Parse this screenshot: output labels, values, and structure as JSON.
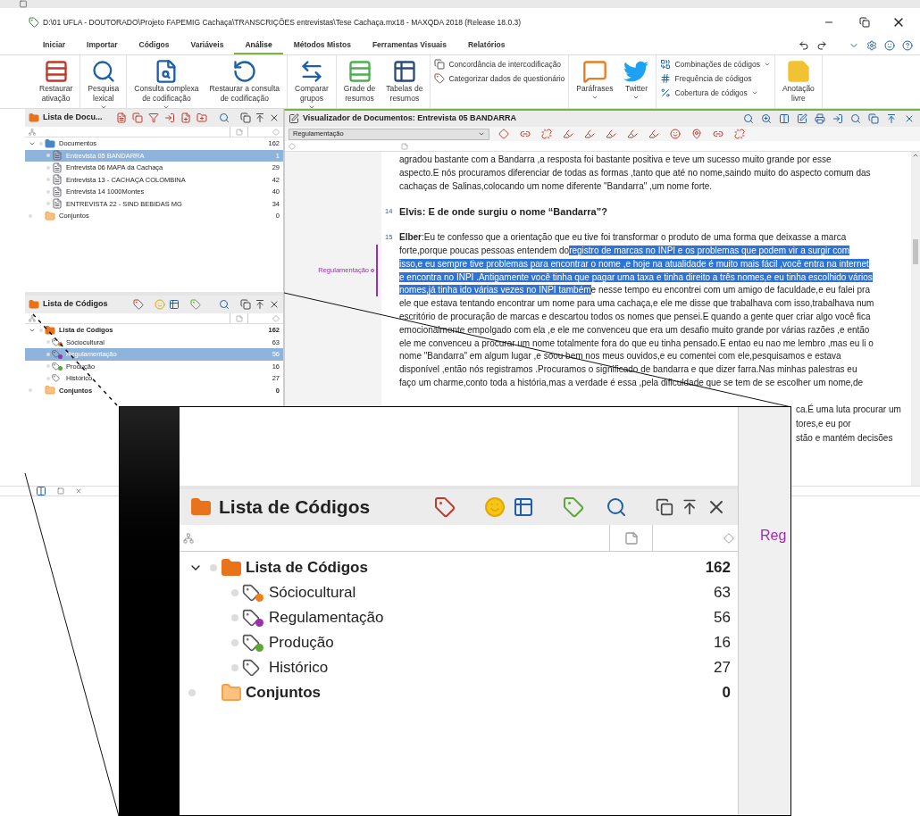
{
  "window": {
    "title": "D:\\01 UFLA - DOUTORADO\\Projeto FAPEMIG Cachaça\\TRANSCRIÇÕES entrevistas\\Tese Cachaça.mx18 - MAXQDA 2018  (Release 18.0.3)"
  },
  "menu_tabs": [
    {
      "label": "Iniciar",
      "selected": false
    },
    {
      "label": "Importar",
      "selected": false
    },
    {
      "label": "Códigos",
      "selected": false
    },
    {
      "label": "Variáveis",
      "selected": false
    },
    {
      "label": "Análise",
      "selected": true
    },
    {
      "label": "Métodos Mistos",
      "selected": false
    },
    {
      "label": "Ferramentas Visuais",
      "selected": false
    },
    {
      "label": "Relatórios",
      "selected": false
    }
  ],
  "ribbon": [
    {
      "kind": "large",
      "items": [
        {
          "lines": [
            "Restaurar",
            "ativação"
          ],
          "menu": false
        }
      ]
    },
    {
      "kind": "large",
      "items": [
        {
          "lines": [
            "Pesquisa",
            "lexical"
          ],
          "menu": true
        }
      ]
    },
    {
      "kind": "large",
      "items": [
        {
          "lines": [
            "Consulta complexa",
            "de codificação"
          ],
          "menu": true
        },
        {
          "lines": [
            "Restaurar a consulta",
            "de codificação"
          ],
          "menu": false
        }
      ]
    },
    {
      "kind": "large",
      "items": [
        {
          "lines": [
            "Comparar",
            "grupos"
          ],
          "menu": true
        }
      ]
    },
    {
      "kind": "large",
      "items": [
        {
          "lines": [
            "Grade de",
            "resumos"
          ],
          "menu": false
        },
        {
          "lines": [
            "Tabelas de",
            "resumos"
          ],
          "menu": false
        }
      ]
    },
    {
      "kind": "stack",
      "items": [
        {
          "label": "Concordância de intercodificação",
          "menu": false
        },
        {
          "label": "Categorizar dados de questionário",
          "menu": false
        }
      ]
    },
    {
      "kind": "large",
      "items": [
        {
          "lines": [
            "Paráfrases"
          ],
          "menu": true
        },
        {
          "lines": [
            "Twitter"
          ],
          "menu": true
        }
      ]
    },
    {
      "kind": "stack",
      "items": [
        {
          "label": "Combinações de códigos",
          "menu": true
        },
        {
          "label": "Frequência de códigos",
          "menu": false
        },
        {
          "label": "Cobertura de códigos",
          "menu": true
        }
      ]
    },
    {
      "kind": "large",
      "items": [
        {
          "lines": [
            "Anotação",
            "livre"
          ],
          "menu": false
        }
      ]
    }
  ],
  "document_list": {
    "title": "Lista de Docu...",
    "root": {
      "label": "Documentos",
      "count": "162",
      "expanded": true,
      "children": [
        {
          "label": "Entrevista 05 BANDARRA",
          "count": "1",
          "selected": true
        },
        {
          "label": "Entrevista 06 MAPA da Cachaça",
          "count": "29",
          "selected": false
        },
        {
          "label": "Entrevista 13 - CACHAÇA COLOMBINA",
          "count": "42",
          "selected": false
        },
        {
          "label": "Entrevista 14 1000Montes",
          "count": "40",
          "selected": false
        },
        {
          "label": "ENTREVISTA 22 - SIND BEBIDAS MG",
          "count": "34",
          "selected": false
        }
      ]
    },
    "sets": {
      "label": "Conjuntos",
      "count": "0"
    }
  },
  "code_list": {
    "title": "Lista de Códigos",
    "root": {
      "label": "Lista de Códigos",
      "count": "162",
      "expanded": true,
      "children": [
        {
          "label": "Sóciocultural",
          "count": "63",
          "selected": false,
          "color": "#f07f1a"
        },
        {
          "label": "Regulamentação",
          "count": "56",
          "selected": true,
          "color": "#9b2fae"
        },
        {
          "label": "Produção",
          "count": "16",
          "selected": false,
          "color": "#5aa832"
        },
        {
          "label": "Histórico",
          "count": "27",
          "selected": false
        }
      ]
    },
    "sets": {
      "label": "Conjuntos",
      "count": "0"
    }
  },
  "viewer": {
    "title": "Visualizador de Documentos: Entrevista 05 BANDARRA",
    "code_dropdown": "Regulamentação",
    "coding_stripe": {
      "label": "Regulamentação",
      "color": "#9b2fae"
    },
    "paragraphs": [
      {
        "bold": false,
        "lines": [
          [
            {
              "text": "agradou bastante com a Bandarra ,a resposta foi bastante positiva e teve um sucesso muito grande por esse",
              "highlighted": false
            }
          ],
          [
            {
              "text": "aspecto.E nós procuramos diferenciar de todas as formas ,tanto que até no nome,saindo muito do aspecto comum das",
              "highlighted": false
            }
          ],
          [
            {
              "text": "cachaças de Salinas,colocando um nome diferente \"Bandarra\" ,um nome forte.",
              "highlighted": false
            }
          ]
        ]
      },
      {
        "number": "14",
        "bold": true,
        "lines": [
          [
            {
              "text": "Elvis: E de onde surgiu o nome “Bandarra”?",
              "highlighted": false
            }
          ]
        ]
      },
      {
        "number": "15",
        "bold": false,
        "lines": [
          [
            {
              "text": "**Elber**:Eu te confesso que a orientação que eu tive foi transformar o produto de uma forma que deixasse a marca",
              "highlighted": false
            }
          ],
          [
            {
              "text": "forte,porque poucas pessoas entendem do",
              "highlighted": false
            },
            {
              "text": "registro de marcas no INPI e os problemas que podem vir a surgir com",
              "highlighted": true
            }
          ],
          [
            {
              "text": "isso,e eu sempre tive problemas para encontrar o nome ,e hoje na atualidade é muito mais fácil ,você entra na internet",
              "highlighted": true
            }
          ],
          [
            {
              "text": "e encontra no INPI .Antigamente você tinha que pagar uma taxa e tinha direito a três nomes,e eu tinha escolhido vários",
              "highlighted": true
            }
          ],
          [
            {
              "text": "nomes,já tinha ido várias vezes no INPI também",
              "highlighted": true
            },
            {
              "text": "e nesse tempo eu encontrei com um amigo de faculdade,e eu falei pra",
              "highlighted": false
            }
          ],
          [
            {
              "text": "ele que estava tentando encontrar um nome para uma cachaça,e ele me disse que trabalhava com isso,trabalhava num",
              "highlighted": false
            }
          ],
          [
            {
              "text": "escritório de procuração de marcas e descartou todos os nomes que pensei.E quando a gente quer criar algo você fica",
              "highlighted": false
            }
          ],
          [
            {
              "text": "emocionalmente empolgado com ela ,e ele me convenceu que era um desafio muito grande por várias razões ,e então",
              "highlighted": false
            }
          ],
          [
            {
              "text": "ele me convenceu a procurar um nome totalmente fora do que eu tinha pensado.E entao eu nao me lembro ,mas eu li o",
              "highlighted": false
            }
          ],
          [
            {
              "text": "nome \"Bandarra\" em algum lugar ,e soou bem nos meus ouvidos,e eu comentei com ele,pesquisamos e estava",
              "highlighted": false
            }
          ],
          [
            {
              "text": "disponível ,então nós registramos .Procuramos o significado de bandarra e que dizer farra.Nas minhas palestras eu",
              "highlighted": false
            }
          ],
          [
            {
              "text": "faço um charme,conto toda a história,mas a verdade é essa ,pela dificuldade que se tem de se escolher um nome,de",
              "highlighted": false
            }
          ]
        ]
      }
    ],
    "visible_line_ends": [
      "ca.É uma luta procurar um",
      "tores,e eu por",
      "stão e mantém decisões"
    ]
  },
  "inset": {
    "code_list": {
      "title": "Lista de Códigos",
      "root": {
        "label": "Lista de Códigos",
        "count": "162",
        "expanded": true,
        "children": [
          {
            "label": "Sóciocultural",
            "count": "63",
            "color": "#f07f1a"
          },
          {
            "label": "Regulamentação",
            "count": "56",
            "color": "#9b2fae"
          },
          {
            "label": "Produção",
            "count": "16",
            "color": "#5aa832"
          },
          {
            "label": "Histórico",
            "count": "27"
          }
        ]
      },
      "sets": {
        "label": "Conjuntos",
        "count": "0"
      }
    },
    "side_label": "Reg"
  }
}
